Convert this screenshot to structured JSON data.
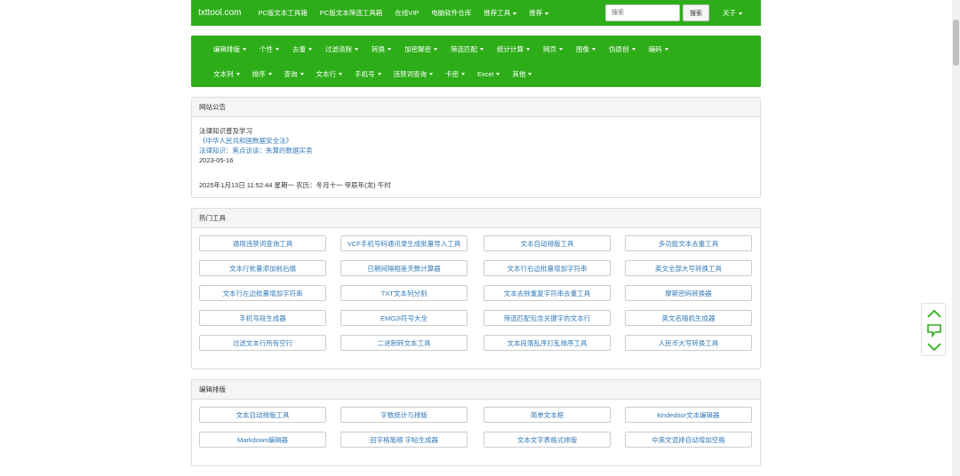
{
  "navbar": {
    "brand": "txttool.com",
    "links": [
      "PC版文本工具箱",
      "PC版文本筛选工具箱",
      "在线VIP",
      "电脑软件仓库",
      "推荐工具",
      "推荐"
    ],
    "search_placeholder": "搜索",
    "search_button": "搜索",
    "about": "关于"
  },
  "categories": {
    "row1": [
      "编辑排版",
      "个性",
      "去重",
      "过滤清除",
      "转换",
      "加密解密",
      "筛选匹配",
      "统计计算",
      "网页",
      "图像",
      "伪原创",
      "编码"
    ],
    "row2": [
      "文本列",
      "排序",
      "查询",
      "文本行",
      "手机号",
      "违禁词查询",
      "卡密",
      "Excel",
      "其他"
    ]
  },
  "notice": {
    "heading": "网站公告",
    "title": "法律知识普及学习",
    "link1": "《中华人民共和国数据安全法》",
    "link2": "法律知识：焦点访谈：失算的数据买卖",
    "date": "2023-05-16",
    "datetime": "2025年1月13日 11:52:44 星期一 农历：冬月十一    甲辰年(龙) 午时"
  },
  "hot_tools": {
    "heading": "热门工具",
    "items": [
      "通用违禁词查询工具",
      "VCF手机号码通讯录生成批量导入工具",
      "文本自动排版工具",
      "多功能文本去重工具",
      "文本行批量添加前后缀",
      "日期间隔相差天数计算器",
      "文本行右边批量增加字符串",
      "英文全部大写转换工具",
      "文本行左边批量增加字符串",
      "TXT文本列分割",
      "文本去除重复字符串去重工具",
      "摩斯密码转换器",
      "手机号段生成器",
      "EMOJI符号大全",
      "筛选匹配包含关键字的文本行",
      "英文名随机生成器",
      "过滤文本行所有空行",
      "二进制转文本工具",
      "文本段落乱序打乱排序工具",
      "人民币大写转换工具"
    ]
  },
  "edit_tools": {
    "heading": "编辑排版",
    "items": [
      "文本自动排版工具",
      "字数统计与排版",
      "简单文本框",
      "kindeditor文本编辑器",
      "Markdown编辑器",
      "田字格笔顺 字帖生成器",
      "文本文字表格式排版",
      "中英文混排自动增加空格"
    ]
  },
  "icons": {
    "up": "chevron-up-icon",
    "comment": "comment-icon",
    "down": "chevron-down-icon"
  },
  "colors": {
    "brand_green": "#2dae19",
    "link_blue": "#337ab7"
  }
}
